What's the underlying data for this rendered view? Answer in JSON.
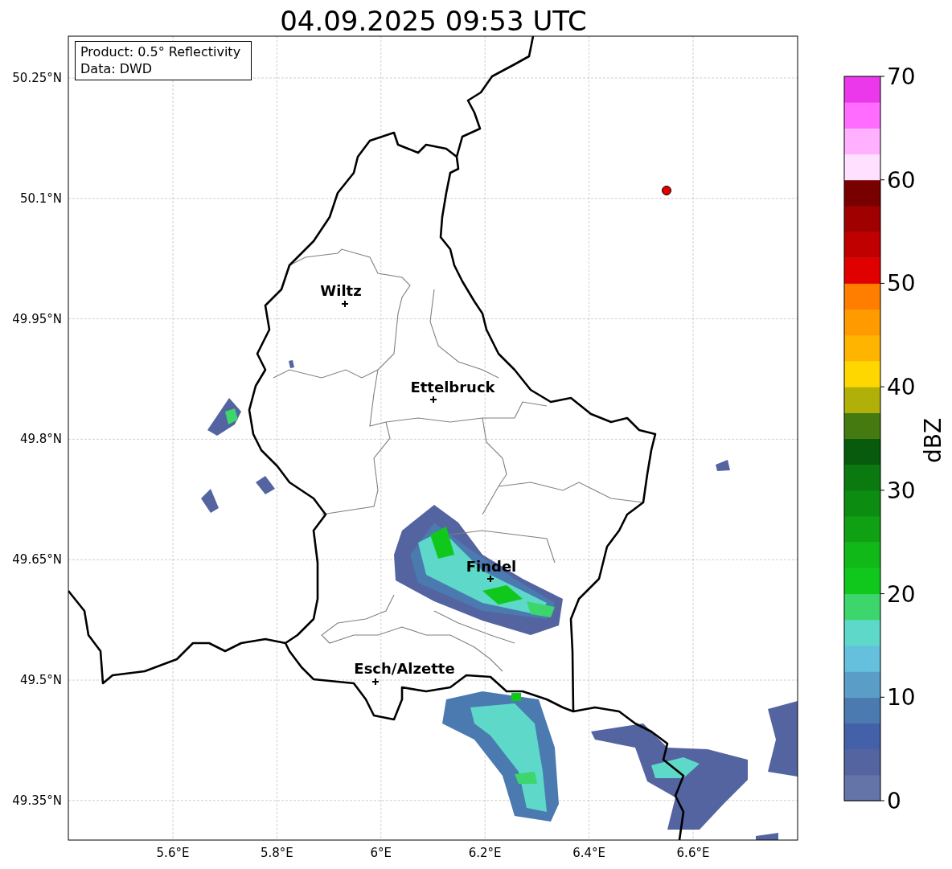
{
  "title": "04.09.2025 09:53 UTC",
  "info_box": [
    "Product: 0.5° Reflectivity",
    "Data: DWD"
  ],
  "y_ticks": [
    "50.25°N",
    "50.1°N",
    "49.95°N",
    "49.8°N",
    "49.65°N",
    "49.5°N",
    "49.35°N"
  ],
  "x_ticks": [
    "5.6°E",
    "5.8°E",
    "6°E",
    "6.2°E",
    "6.4°E",
    "6.6°E"
  ],
  "cities": [
    {
      "name": "Wiltz"
    },
    {
      "name": "Ettelbruck"
    },
    {
      "name": "Findel"
    },
    {
      "name": "Esch/Alzette"
    }
  ],
  "colorbar": {
    "label": "dBZ",
    "ticks": [
      "70",
      "60",
      "50",
      "40",
      "30",
      "20",
      "10",
      "0"
    ],
    "bands": [
      {
        "color": "#6474a8"
      },
      {
        "color": "#5464a0"
      },
      {
        "color": "#4460a8"
      },
      {
        "color": "#4a7ab0"
      },
      {
        "color": "#5a9ec8"
      },
      {
        "color": "#64c0dc"
      },
      {
        "color": "#5ed8c8"
      },
      {
        "color": "#3cd66c"
      },
      {
        "color": "#10c81c"
      },
      {
        "color": "#10b818"
      },
      {
        "color": "#10a014"
      },
      {
        "color": "#0c8c10"
      },
      {
        "color": "#0a7a10"
      },
      {
        "color": "#085a0c"
      },
      {
        "color": "#447a10"
      },
      {
        "color": "#b0b008"
      },
      {
        "color": "#ffd700"
      },
      {
        "color": "#ffb400"
      },
      {
        "color": "#ff9a00"
      },
      {
        "color": "#ff7e00"
      },
      {
        "color": "#e00000"
      },
      {
        "color": "#c00000"
      },
      {
        "color": "#a00000"
      },
      {
        "color": "#780000"
      },
      {
        "color": "#ffe0ff"
      },
      {
        "color": "#ffb0ff"
      },
      {
        "color": "#ff6cff"
      },
      {
        "color": "#ea38ea"
      }
    ]
  }
}
